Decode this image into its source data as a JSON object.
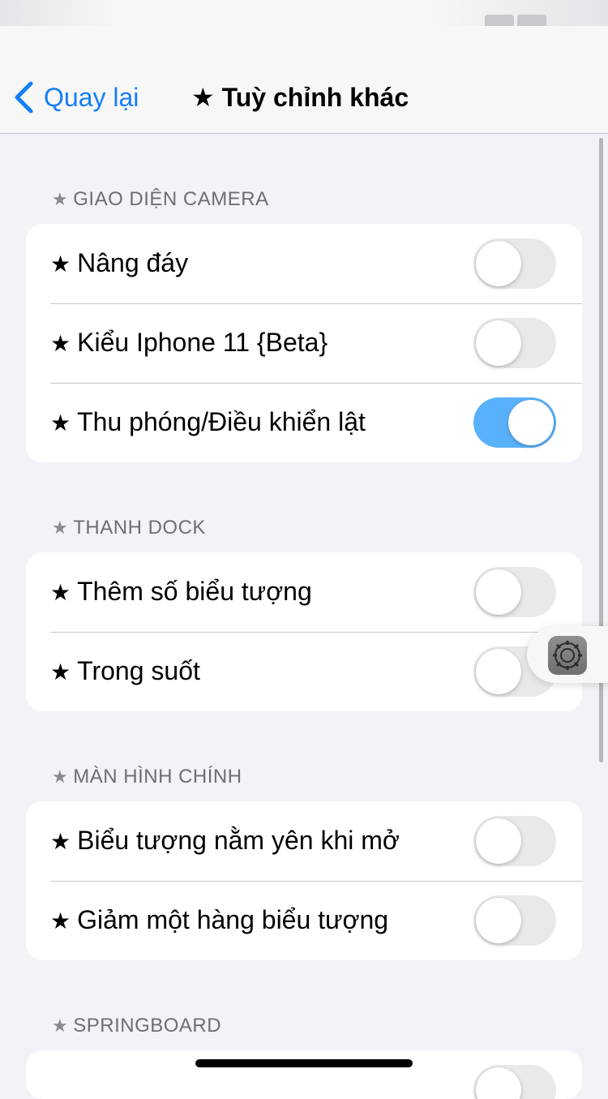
{
  "nav": {
    "back_label": "Quay lại",
    "title": "Tuỳ chỉnh khác",
    "star_icon": "★"
  },
  "sections": [
    {
      "header": "GIAO DIỆN CAMERA",
      "rows": [
        {
          "label": "Nâng đáy",
          "on": false
        },
        {
          "label": "Kiểu Iphone 11 {Beta}",
          "on": false
        },
        {
          "label": "Thu phóng/Điều khiển lật",
          "on": true
        }
      ]
    },
    {
      "header": "THANH DOCK",
      "rows": [
        {
          "label": "Thêm số biểu tượng",
          "on": false
        },
        {
          "label": "Trong suốt",
          "on": false
        }
      ]
    },
    {
      "header": "MÀN HÌNH CHÍNH",
      "rows": [
        {
          "label": "Biểu tượng nằm yên khi mở",
          "on": false
        },
        {
          "label": "Giảm một hàng biểu tượng",
          "on": false
        }
      ]
    },
    {
      "header": "SPRINGBOARD",
      "rows": []
    }
  ],
  "colors": {
    "accent": "#147efb",
    "toggle_on": "#5ab1fb",
    "toggle_off": "#e9e9eb",
    "background": "#f2f2f7"
  },
  "icons": {
    "back": "chevron-left-icon",
    "star": "star-icon",
    "assistive": "gear-icon"
  }
}
